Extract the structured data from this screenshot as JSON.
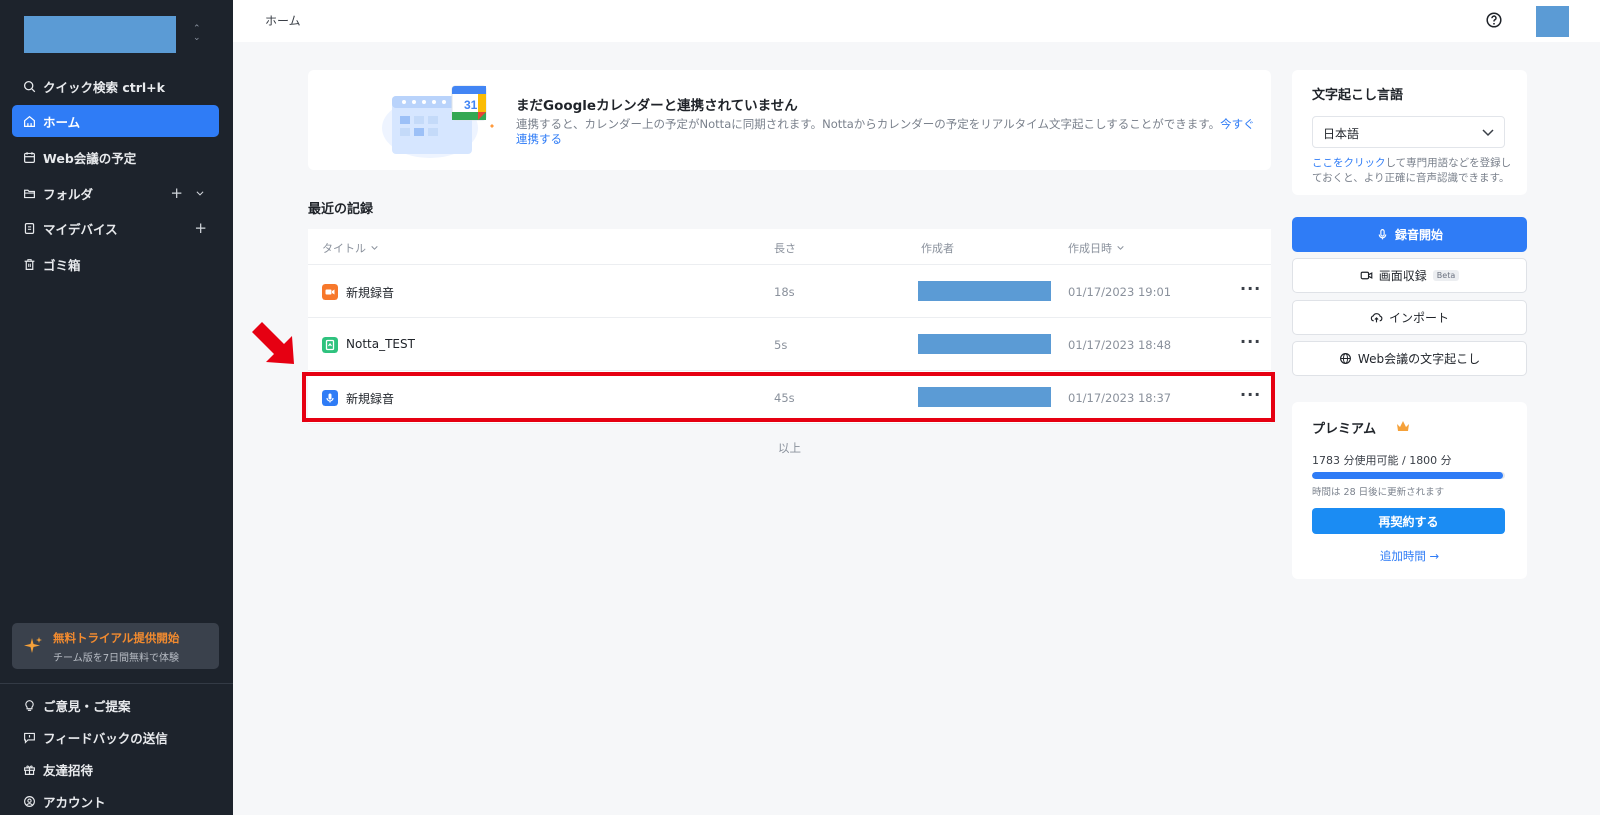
{
  "topbar": {
    "breadcrumb": "ホーム"
  },
  "sidebar": {
    "items": [
      {
        "label": "クイック検索 ctrl+k",
        "icon": "search-icon"
      },
      {
        "label": "ホーム",
        "icon": "home-icon",
        "active": true
      },
      {
        "label": "Web会議の予定",
        "icon": "calendar-icon"
      },
      {
        "label": "フォルダ",
        "icon": "folder-icon"
      },
      {
        "label": "マイデバイス",
        "icon": "device-icon"
      },
      {
        "label": "ゴミ箱",
        "icon": "trash-icon"
      }
    ],
    "plus": "+",
    "trial": {
      "title": "無料トライアル提供開始",
      "subtitle": "チーム版を7日間無料で体験"
    },
    "bottom": [
      {
        "label": "ご意見・ご提案",
        "icon": "lightbulb-icon"
      },
      {
        "label": "フィードバックの送信",
        "icon": "feedback-icon"
      },
      {
        "label": "友達招待",
        "icon": "gift-icon"
      },
      {
        "label": "アカウント",
        "icon": "account-icon"
      }
    ]
  },
  "banner": {
    "title": "まだGoogleカレンダーと連携されていません",
    "desc": "連携すると、カレンダー上の予定がNottaに同期されます。Nottaからカレンダーの予定をリアルタイム文字起こしすることができます。",
    "link": "今すぐ連携する",
    "calendar_day": "31"
  },
  "records": {
    "title": "最近の記録",
    "headers": {
      "title": "タイトル",
      "length": "長さ",
      "author": "作成者",
      "date": "作成日時"
    },
    "rows": [
      {
        "name": "新規録音",
        "length": "18s",
        "date": "01/17/2023 19:01",
        "icon_color": "#f7782b",
        "icon": "video-icon"
      },
      {
        "name": "Notta_TEST",
        "length": "5s",
        "date": "01/17/2023 18:48",
        "icon_color": "#2ec27e",
        "icon": "file-icon"
      },
      {
        "name": "新規録音",
        "length": "45s",
        "date": "01/17/2023 18:37",
        "icon_color": "#2f7cf6",
        "icon": "mic-icon"
      }
    ],
    "more": "···",
    "end": "以上"
  },
  "language": {
    "title": "文字起こし言語",
    "selected": "日本語",
    "note_link": "ここをクリック",
    "note": "して専門用語などを登録しておくと、より正確に音声認識できます。"
  },
  "actions": {
    "record": "録音開始",
    "screen": "画面収録",
    "beta": "Beta",
    "import": "インポート",
    "web": "Web会議の文字起こし"
  },
  "premium": {
    "title": "プレミアム",
    "usage": "1783 分使用可能 / 1800 分",
    "usage_fraction": 0.99,
    "note": "時間は 28 日後に更新されます",
    "renew": "再契約する",
    "add": "追加時間 →"
  },
  "colors": {
    "accent": "#2f7cf6",
    "sidebar": "#1d232c",
    "highlight": "#e60012"
  }
}
